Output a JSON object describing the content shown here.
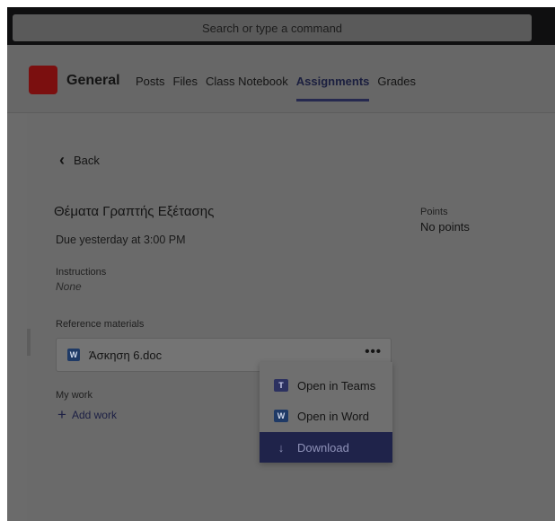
{
  "search": {
    "placeholder": "Search or type a command"
  },
  "header": {
    "channel_name": "General",
    "tabs": [
      {
        "label": "Posts",
        "active": false
      },
      {
        "label": "Files",
        "active": false
      },
      {
        "label": "Class Notebook",
        "active": false
      },
      {
        "label": "Assignments",
        "active": true
      },
      {
        "label": "Grades",
        "active": false
      }
    ]
  },
  "assignment": {
    "back_label": "Back",
    "title": "Θέματα Γραπτής Εξέτασης",
    "due": "Due yesterday at 3:00 PM",
    "points_label": "Points",
    "points_value": "No points",
    "instructions_label": "Instructions",
    "instructions_value": "None",
    "reference_label": "Reference materials",
    "file_name": "Άσκηση 6.doc",
    "more_label": "•••",
    "my_work_label": "My work",
    "add_work_label": "Add work"
  },
  "context_menu": {
    "items": [
      {
        "label": "Open in Teams",
        "icon": "teams-icon"
      },
      {
        "label": "Open in Word",
        "icon": "word-icon"
      },
      {
        "label": "Download",
        "icon": "download-icon"
      }
    ]
  },
  "colors": {
    "accent": "#26294f",
    "team_logo": "#7b0f0f"
  }
}
